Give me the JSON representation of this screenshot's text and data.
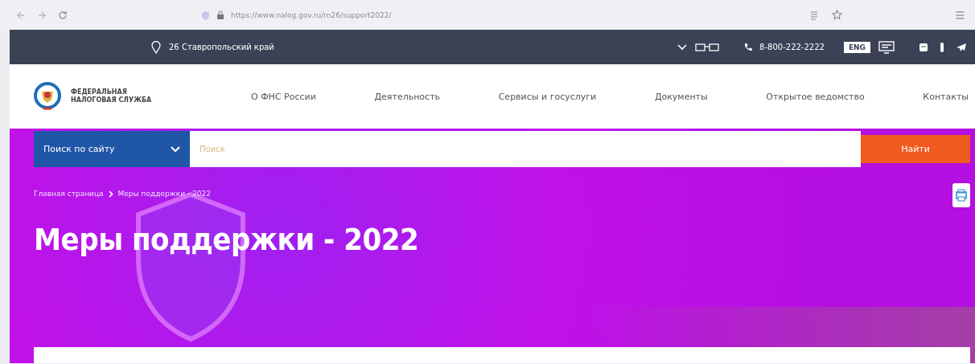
{
  "browser": {
    "url": "https://www.nalog.gov.ru/rn26/support2022/"
  },
  "top_bar": {
    "region": "26 Ставропольский край",
    "phone": "8-800-222-2222",
    "language": "ENG"
  },
  "header": {
    "logo_line_1": "ФЕДЕРАЛЬНАЯ",
    "logo_line_2": "НАЛОГОВАЯ СЛУЖБА",
    "nav": [
      "О ФНС России",
      "Деятельность",
      "Сервисы и госуслуги",
      "Документы",
      "Открытое ведомство",
      "Контакты"
    ]
  },
  "search": {
    "scope": "Поиск по сайту",
    "placeholder": "Поиск",
    "button": "Найти"
  },
  "breadcrumbs": [
    "Главная страница",
    "Меры поддержки - 2022"
  ],
  "title": "Меры поддержки - 2022"
}
